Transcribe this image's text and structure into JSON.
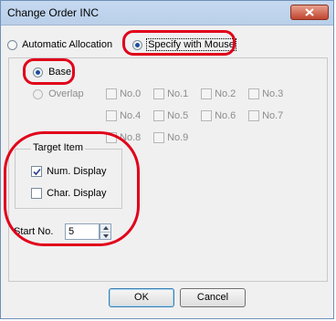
{
  "window": {
    "title": "Change Order INC",
    "close_icon": "close-icon"
  },
  "mode": {
    "automatic_label": "Automatic Allocation",
    "specify_label": "Specify with Mouse",
    "selected": "specify"
  },
  "target": {
    "base_label": "Base",
    "overlap_label": "Overlap",
    "selected": "base",
    "overlap_items": [
      "No.0",
      "No.1",
      "No.2",
      "No.3",
      "No.4",
      "No.5",
      "No.6",
      "No.7",
      "No.8",
      "No.9"
    ]
  },
  "target_item": {
    "group_label": "Target Item",
    "num_display_label": "Num. Display",
    "num_display_checked": true,
    "char_display_label": "Char. Display",
    "char_display_checked": false
  },
  "start_no": {
    "label": "Start No.",
    "value": "5"
  },
  "buttons": {
    "ok": "OK",
    "cancel": "Cancel"
  },
  "colors": {
    "highlight_ring": "#e1001a",
    "title_bar": "#c6d9f1",
    "close_button": "#c0452e"
  }
}
